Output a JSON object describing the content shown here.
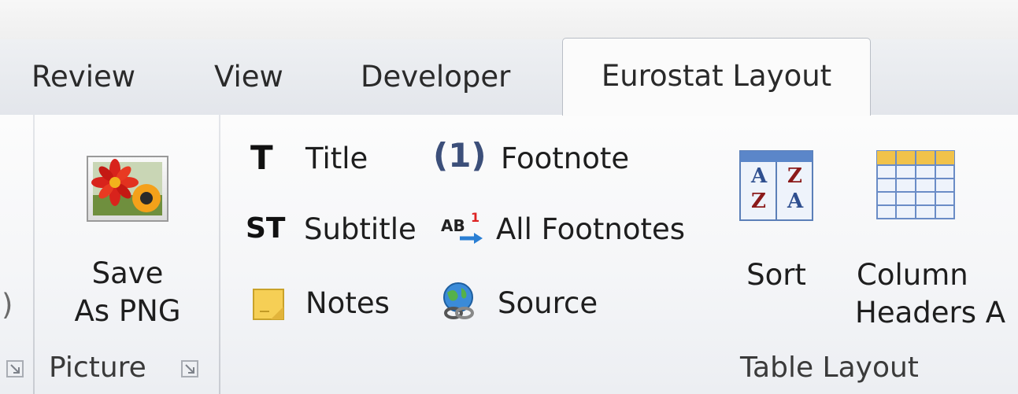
{
  "tabs": [
    {
      "label": "Review"
    },
    {
      "label": "View"
    },
    {
      "label": "Developer"
    },
    {
      "label": "Eurostat Layout"
    }
  ],
  "active_tab": "Eurostat Layout",
  "ribbon": {
    "left_edge_partial_text": ")",
    "picture_group": {
      "label": "Picture",
      "save_button": {
        "line1": "Save",
        "line2": "As PNG"
      }
    },
    "table_layout_group": {
      "label": "Table Layout",
      "title": {
        "icon_text": "T",
        "label": "Title"
      },
      "subtitle": {
        "icon_text": "ST",
        "label": "Subtitle"
      },
      "notes": {
        "label": "Notes"
      },
      "footnote": {
        "icon_text": "(1)",
        "label": "Footnote"
      },
      "all_footnotes": {
        "icon_text": "AB",
        "icon_sup": "1",
        "label": "All Footnotes"
      },
      "source": {
        "label": "Source"
      },
      "sort": {
        "label": "Sort",
        "icon_letters": [
          "A",
          "Z",
          "Z",
          "A"
        ]
      },
      "column_headers": {
        "line1": "Column",
        "line2": "Headers A"
      }
    }
  },
  "colors": {
    "active_tab_bg": "#fbfbfb",
    "ribbon_bg": "#f5f6f8",
    "tab_border": "#b9bec6",
    "footnote_icon": "#3c4f7a",
    "sort_blue": "#2f4f8f",
    "sort_red": "#8b1a1a"
  }
}
